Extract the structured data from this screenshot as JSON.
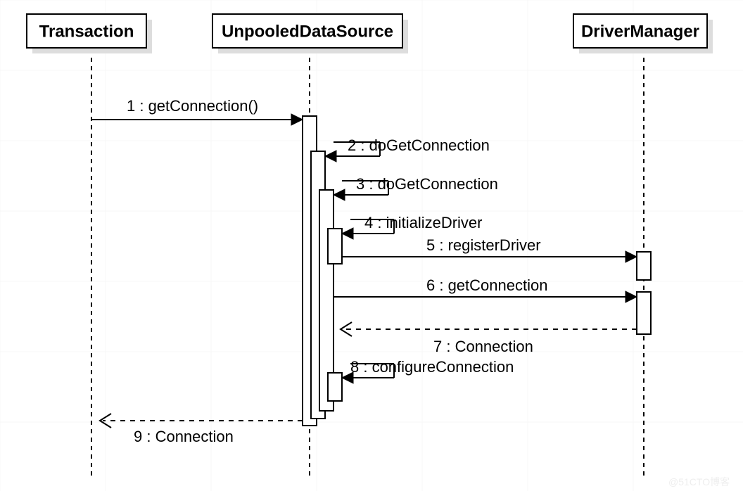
{
  "participants": {
    "p1": "Transaction",
    "p2": "UnpooledDataSource",
    "p3": "DriverManager"
  },
  "messages": {
    "m1": "1 : getConnection()",
    "m2": "2 : doGetConnection",
    "m3": "3 : doGetConnection",
    "m4": "4 : initializeDriver",
    "m5": "5 : registerDriver",
    "m6": "6 : getConnection",
    "m7": "7 : Connection",
    "m8": "8 : configureConnection",
    "m9": "9 : Connection"
  },
  "watermark": "@51CTO博客",
  "chart_data": {
    "type": "sequence-diagram",
    "participants": [
      "Transaction",
      "UnpooledDataSource",
      "DriverManager"
    ],
    "messages": [
      {
        "seq": 1,
        "from": "Transaction",
        "to": "UnpooledDataSource",
        "label": "getConnection()",
        "kind": "sync",
        "style": "solid"
      },
      {
        "seq": 2,
        "from": "UnpooledDataSource",
        "to": "UnpooledDataSource",
        "label": "doGetConnection",
        "kind": "self",
        "style": "solid"
      },
      {
        "seq": 3,
        "from": "UnpooledDataSource",
        "to": "UnpooledDataSource",
        "label": "doGetConnection",
        "kind": "self",
        "style": "solid"
      },
      {
        "seq": 4,
        "from": "UnpooledDataSource",
        "to": "UnpooledDataSource",
        "label": "initializeDriver",
        "kind": "self",
        "style": "solid"
      },
      {
        "seq": 5,
        "from": "UnpooledDataSource",
        "to": "DriverManager",
        "label": "registerDriver",
        "kind": "sync",
        "style": "solid"
      },
      {
        "seq": 6,
        "from": "UnpooledDataSource",
        "to": "DriverManager",
        "label": "getConnection",
        "kind": "sync",
        "style": "solid"
      },
      {
        "seq": 7,
        "from": "DriverManager",
        "to": "UnpooledDataSource",
        "label": "Connection",
        "kind": "return",
        "style": "dashed"
      },
      {
        "seq": 8,
        "from": "UnpooledDataSource",
        "to": "UnpooledDataSource",
        "label": "configureConnection",
        "kind": "self",
        "style": "solid"
      },
      {
        "seq": 9,
        "from": "UnpooledDataSource",
        "to": "Transaction",
        "label": "Connection",
        "kind": "return",
        "style": "dashed"
      }
    ]
  }
}
